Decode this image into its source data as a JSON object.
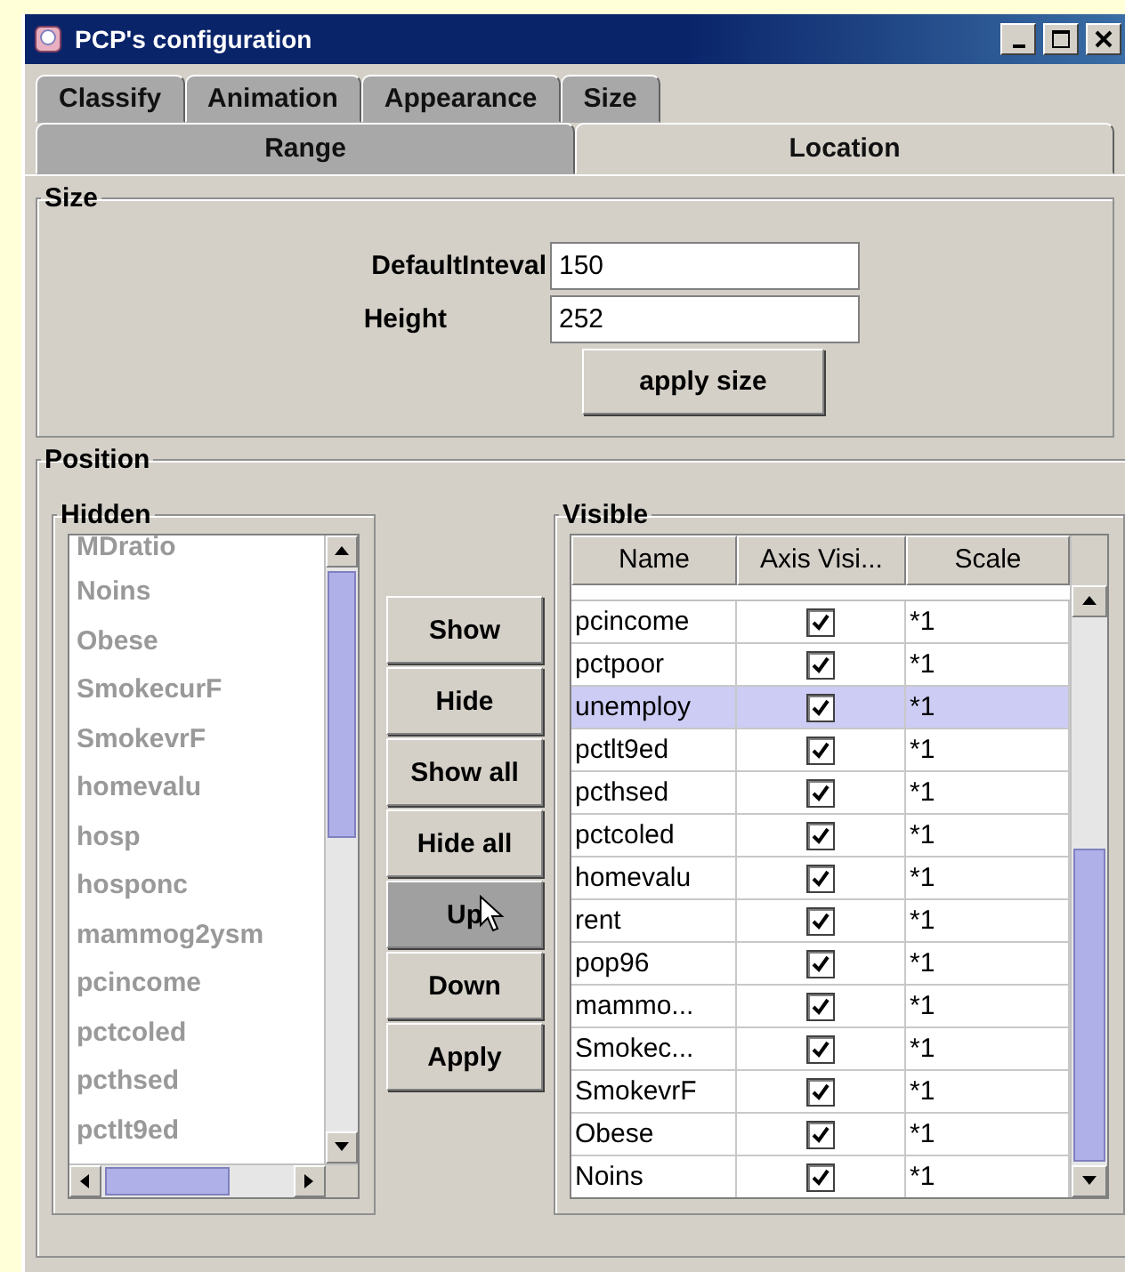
{
  "window": {
    "title": "PCP's configuration"
  },
  "tab_rows": [
    {
      "tabs": [
        {
          "label": "Classify",
          "selected": false
        },
        {
          "label": "Animation",
          "selected": false
        },
        {
          "label": "Appearance",
          "selected": false
        },
        {
          "label": "Size",
          "selected": false
        }
      ]
    },
    {
      "tabs": [
        {
          "label": "Range",
          "selected": false
        },
        {
          "label": "Location",
          "selected": true
        }
      ]
    }
  ],
  "size": {
    "title": "Size",
    "fields": [
      {
        "label": "DefaultInteval",
        "value": "150"
      },
      {
        "label": "Height",
        "value": "252"
      }
    ],
    "button": "apply size"
  },
  "position": {
    "title": "Position",
    "hidden": {
      "title": "Hidden",
      "items": [
        "MDratio",
        "Noins",
        "Obese",
        "SmokecurF",
        "SmokevrF",
        "homevalu",
        "hosp",
        "hosponc",
        "mammog2ysm",
        "pcincome",
        "pctcoled",
        "pcthsed",
        "pctlt9ed"
      ]
    },
    "buttons": [
      {
        "label": "Show",
        "pressed": false
      },
      {
        "label": "Hide",
        "pressed": false
      },
      {
        "label": "Show all",
        "pressed": false
      },
      {
        "label": "Hide all",
        "pressed": false
      },
      {
        "label": "Up",
        "pressed": true
      },
      {
        "label": "Down",
        "pressed": false
      },
      {
        "label": "Apply",
        "pressed": false
      }
    ],
    "visible": {
      "title": "Visible",
      "columns": [
        "Name",
        "Axis Visi...",
        "Scale"
      ],
      "rows": [
        {
          "name": "pcincome",
          "axis_visible": true,
          "scale": "*1",
          "selected": false
        },
        {
          "name": "pctpoor",
          "axis_visible": true,
          "scale": "*1",
          "selected": false
        },
        {
          "name": "unemploy",
          "axis_visible": true,
          "scale": "*1",
          "selected": true
        },
        {
          "name": "pctlt9ed",
          "axis_visible": true,
          "scale": "*1",
          "selected": false
        },
        {
          "name": "pcthsed",
          "axis_visible": true,
          "scale": "*1",
          "selected": false
        },
        {
          "name": "pctcoled",
          "axis_visible": true,
          "scale": "*1",
          "selected": false
        },
        {
          "name": "homevalu",
          "axis_visible": true,
          "scale": "*1",
          "selected": false
        },
        {
          "name": "rent",
          "axis_visible": true,
          "scale": "*1",
          "selected": false
        },
        {
          "name": "pop96",
          "axis_visible": true,
          "scale": "*1",
          "selected": false
        },
        {
          "name": "mammo...",
          "axis_visible": true,
          "scale": "*1",
          "selected": false
        },
        {
          "name": "Smokec...",
          "axis_visible": true,
          "scale": "*1",
          "selected": false
        },
        {
          "name": "SmokevrF",
          "axis_visible": true,
          "scale": "*1",
          "selected": false
        },
        {
          "name": "Obese",
          "axis_visible": true,
          "scale": "*1",
          "selected": false
        },
        {
          "name": "Noins",
          "axis_visible": true,
          "scale": "*1",
          "selected": false
        }
      ]
    }
  }
}
